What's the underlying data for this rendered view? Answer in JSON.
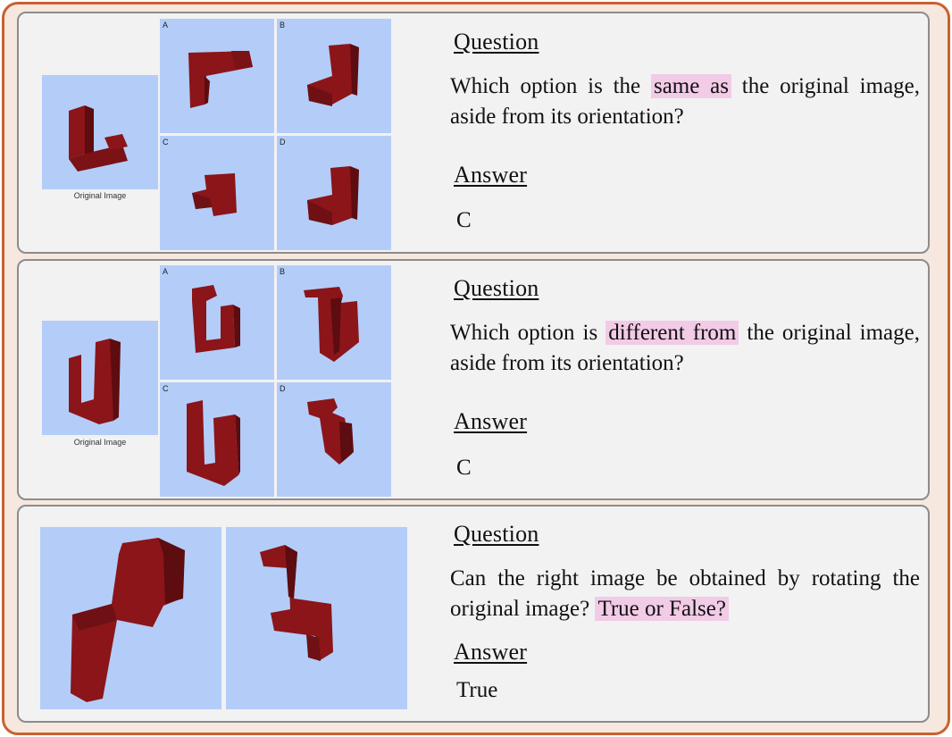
{
  "panels": [
    {
      "original_caption": "Original Image",
      "option_labels": [
        "A",
        "B",
        "C",
        "D"
      ],
      "question_heading": "Question",
      "question_before": "Which option is the",
      "question_highlight": "same as",
      "question_after": "the original image, aside from its orientation?",
      "answer_heading": "Answer",
      "answer": "C"
    },
    {
      "original_caption": "Original Image",
      "option_labels": [
        "A",
        "B",
        "C",
        "D"
      ],
      "question_heading": "Question",
      "question_before": "Which option is",
      "question_highlight": "different from",
      "question_after": "the original image, aside from its orientation?",
      "answer_heading": "Answer",
      "answer": "C"
    },
    {
      "question_heading": "Question",
      "question_before": "Can the right image be obtained by rotating the original image?",
      "question_highlight": "True or False?",
      "question_after": "",
      "answer_heading": "Answer",
      "answer": "True"
    }
  ],
  "colors": {
    "frame": "#c9612f",
    "panel_bg": "#f2f2f2",
    "sky": "#b3cdf8",
    "block": "#8b1519",
    "highlight": "#f2cbe6"
  }
}
